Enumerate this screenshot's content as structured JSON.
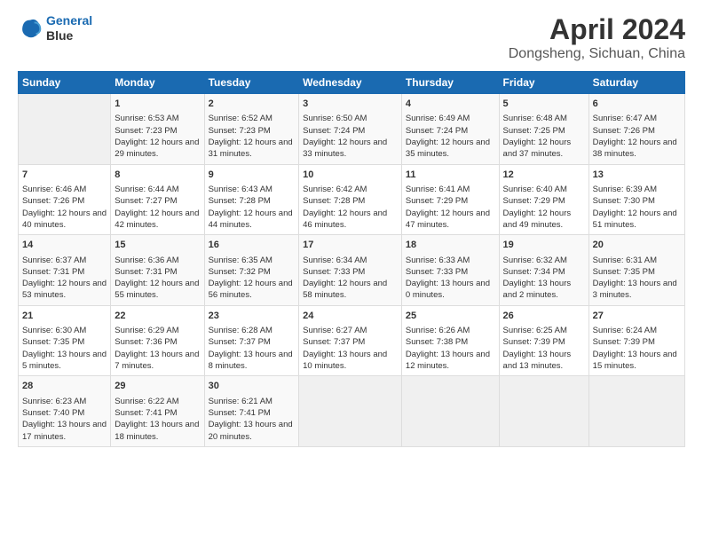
{
  "logo": {
    "line1": "General",
    "line2": "Blue"
  },
  "title": "April 2024",
  "subtitle": "Dongsheng, Sichuan, China",
  "days_of_week": [
    "Sunday",
    "Monday",
    "Tuesday",
    "Wednesday",
    "Thursday",
    "Friday",
    "Saturday"
  ],
  "weeks": [
    [
      {
        "day": "",
        "data": ""
      },
      {
        "day": "1",
        "sunrise": "Sunrise: 6:53 AM",
        "sunset": "Sunset: 7:23 PM",
        "daylight": "Daylight: 12 hours and 29 minutes."
      },
      {
        "day": "2",
        "sunrise": "Sunrise: 6:52 AM",
        "sunset": "Sunset: 7:23 PM",
        "daylight": "Daylight: 12 hours and 31 minutes."
      },
      {
        "day": "3",
        "sunrise": "Sunrise: 6:50 AM",
        "sunset": "Sunset: 7:24 PM",
        "daylight": "Daylight: 12 hours and 33 minutes."
      },
      {
        "day": "4",
        "sunrise": "Sunrise: 6:49 AM",
        "sunset": "Sunset: 7:24 PM",
        "daylight": "Daylight: 12 hours and 35 minutes."
      },
      {
        "day": "5",
        "sunrise": "Sunrise: 6:48 AM",
        "sunset": "Sunset: 7:25 PM",
        "daylight": "Daylight: 12 hours and 37 minutes."
      },
      {
        "day": "6",
        "sunrise": "Sunrise: 6:47 AM",
        "sunset": "Sunset: 7:26 PM",
        "daylight": "Daylight: 12 hours and 38 minutes."
      }
    ],
    [
      {
        "day": "7",
        "sunrise": "Sunrise: 6:46 AM",
        "sunset": "Sunset: 7:26 PM",
        "daylight": "Daylight: 12 hours and 40 minutes."
      },
      {
        "day": "8",
        "sunrise": "Sunrise: 6:44 AM",
        "sunset": "Sunset: 7:27 PM",
        "daylight": "Daylight: 12 hours and 42 minutes."
      },
      {
        "day": "9",
        "sunrise": "Sunrise: 6:43 AM",
        "sunset": "Sunset: 7:28 PM",
        "daylight": "Daylight: 12 hours and 44 minutes."
      },
      {
        "day": "10",
        "sunrise": "Sunrise: 6:42 AM",
        "sunset": "Sunset: 7:28 PM",
        "daylight": "Daylight: 12 hours and 46 minutes."
      },
      {
        "day": "11",
        "sunrise": "Sunrise: 6:41 AM",
        "sunset": "Sunset: 7:29 PM",
        "daylight": "Daylight: 12 hours and 47 minutes."
      },
      {
        "day": "12",
        "sunrise": "Sunrise: 6:40 AM",
        "sunset": "Sunset: 7:29 PM",
        "daylight": "Daylight: 12 hours and 49 minutes."
      },
      {
        "day": "13",
        "sunrise": "Sunrise: 6:39 AM",
        "sunset": "Sunset: 7:30 PM",
        "daylight": "Daylight: 12 hours and 51 minutes."
      }
    ],
    [
      {
        "day": "14",
        "sunrise": "Sunrise: 6:37 AM",
        "sunset": "Sunset: 7:31 PM",
        "daylight": "Daylight: 12 hours and 53 minutes."
      },
      {
        "day": "15",
        "sunrise": "Sunrise: 6:36 AM",
        "sunset": "Sunset: 7:31 PM",
        "daylight": "Daylight: 12 hours and 55 minutes."
      },
      {
        "day": "16",
        "sunrise": "Sunrise: 6:35 AM",
        "sunset": "Sunset: 7:32 PM",
        "daylight": "Daylight: 12 hours and 56 minutes."
      },
      {
        "day": "17",
        "sunrise": "Sunrise: 6:34 AM",
        "sunset": "Sunset: 7:33 PM",
        "daylight": "Daylight: 12 hours and 58 minutes."
      },
      {
        "day": "18",
        "sunrise": "Sunrise: 6:33 AM",
        "sunset": "Sunset: 7:33 PM",
        "daylight": "Daylight: 13 hours and 0 minutes."
      },
      {
        "day": "19",
        "sunrise": "Sunrise: 6:32 AM",
        "sunset": "Sunset: 7:34 PM",
        "daylight": "Daylight: 13 hours and 2 minutes."
      },
      {
        "day": "20",
        "sunrise": "Sunrise: 6:31 AM",
        "sunset": "Sunset: 7:35 PM",
        "daylight": "Daylight: 13 hours and 3 minutes."
      }
    ],
    [
      {
        "day": "21",
        "sunrise": "Sunrise: 6:30 AM",
        "sunset": "Sunset: 7:35 PM",
        "daylight": "Daylight: 13 hours and 5 minutes."
      },
      {
        "day": "22",
        "sunrise": "Sunrise: 6:29 AM",
        "sunset": "Sunset: 7:36 PM",
        "daylight": "Daylight: 13 hours and 7 minutes."
      },
      {
        "day": "23",
        "sunrise": "Sunrise: 6:28 AM",
        "sunset": "Sunset: 7:37 PM",
        "daylight": "Daylight: 13 hours and 8 minutes."
      },
      {
        "day": "24",
        "sunrise": "Sunrise: 6:27 AM",
        "sunset": "Sunset: 7:37 PM",
        "daylight": "Daylight: 13 hours and 10 minutes."
      },
      {
        "day": "25",
        "sunrise": "Sunrise: 6:26 AM",
        "sunset": "Sunset: 7:38 PM",
        "daylight": "Daylight: 13 hours and 12 minutes."
      },
      {
        "day": "26",
        "sunrise": "Sunrise: 6:25 AM",
        "sunset": "Sunset: 7:39 PM",
        "daylight": "Daylight: 13 hours and 13 minutes."
      },
      {
        "day": "27",
        "sunrise": "Sunrise: 6:24 AM",
        "sunset": "Sunset: 7:39 PM",
        "daylight": "Daylight: 13 hours and 15 minutes."
      }
    ],
    [
      {
        "day": "28",
        "sunrise": "Sunrise: 6:23 AM",
        "sunset": "Sunset: 7:40 PM",
        "daylight": "Daylight: 13 hours and 17 minutes."
      },
      {
        "day": "29",
        "sunrise": "Sunrise: 6:22 AM",
        "sunset": "Sunset: 7:41 PM",
        "daylight": "Daylight: 13 hours and 18 minutes."
      },
      {
        "day": "30",
        "sunrise": "Sunrise: 6:21 AM",
        "sunset": "Sunset: 7:41 PM",
        "daylight": "Daylight: 13 hours and 20 minutes."
      },
      {
        "day": "",
        "data": ""
      },
      {
        "day": "",
        "data": ""
      },
      {
        "day": "",
        "data": ""
      },
      {
        "day": "",
        "data": ""
      }
    ]
  ]
}
